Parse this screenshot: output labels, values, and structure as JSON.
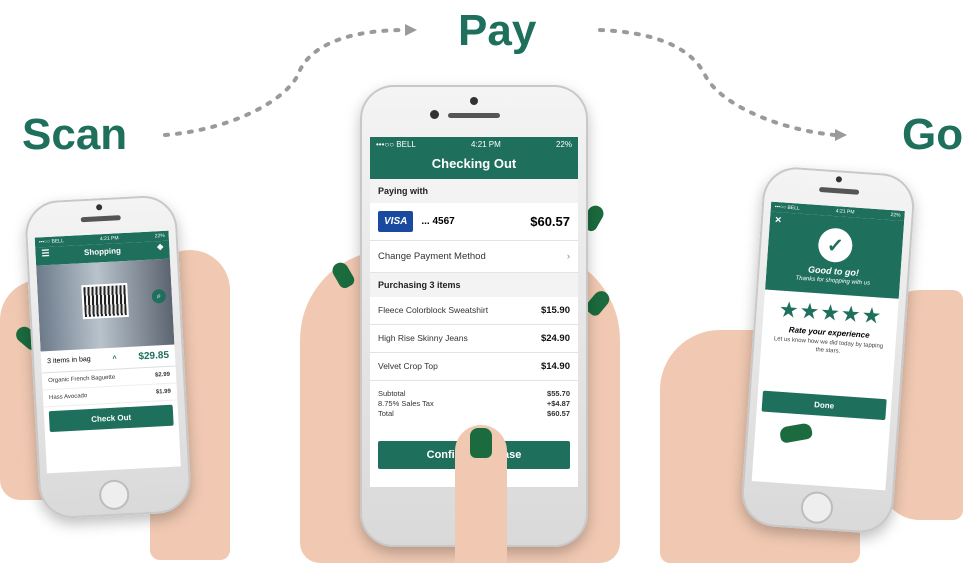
{
  "headings": {
    "scan": "Scan",
    "pay": "Pay",
    "go": "Go"
  },
  "colors": {
    "brand_green": "#1e6f5c",
    "visa_blue": "#1a4aa0"
  },
  "center_phone": {
    "status": {
      "carrier": "•••○○ BELL",
      "time": "4:21 PM",
      "battery": "22%"
    },
    "title": "Checking Out",
    "paying_with_label": "Paying with",
    "card": {
      "brand": "VISA",
      "number": "... 4567",
      "total": "$60.57"
    },
    "change_payment_label": "Change Payment Method",
    "change_payment_chevron": "›",
    "purchasing_label": "Purchasing 3 items",
    "items": [
      {
        "name": "Fleece Colorblock Sweatshirt",
        "price": "$15.90"
      },
      {
        "name": "High Rise Skinny Jeans",
        "price": "$24.90"
      },
      {
        "name": "Velvet Crop Top",
        "price": "$14.90"
      }
    ],
    "summary": [
      {
        "label": "Subtotal",
        "value": "$55.70"
      },
      {
        "label": "8.75% Sales Tax",
        "value": "+$4.87"
      },
      {
        "label": "Total",
        "value": "$60.57"
      }
    ],
    "confirm_button": "Confirm Purchase"
  },
  "left_phone": {
    "status": {
      "carrier": "•••○○ BELL",
      "time": "4:21 PM",
      "battery": "22%"
    },
    "title": "Shopping",
    "bag_label": "3 items in bag",
    "bag_total": "$29.85",
    "items": [
      {
        "name": "Organic French Baguette",
        "price": "$2.99"
      },
      {
        "name": "Hass Avocado",
        "price": "$1.99"
      }
    ],
    "checkout_button": "Check Out"
  },
  "right_phone": {
    "status": {
      "carrier": "•••○○ BELL",
      "time": "4:21 PM",
      "battery": "22%"
    },
    "close_symbol": "×",
    "heading": "Good to go!",
    "subheading": "Thanks for shopping with us",
    "stars": "★★★★★",
    "rating": 5,
    "rate_title": "Rate your experience",
    "rate_subtitle": "Let us know how we did today by tapping the stars.",
    "done_button": "Done"
  }
}
